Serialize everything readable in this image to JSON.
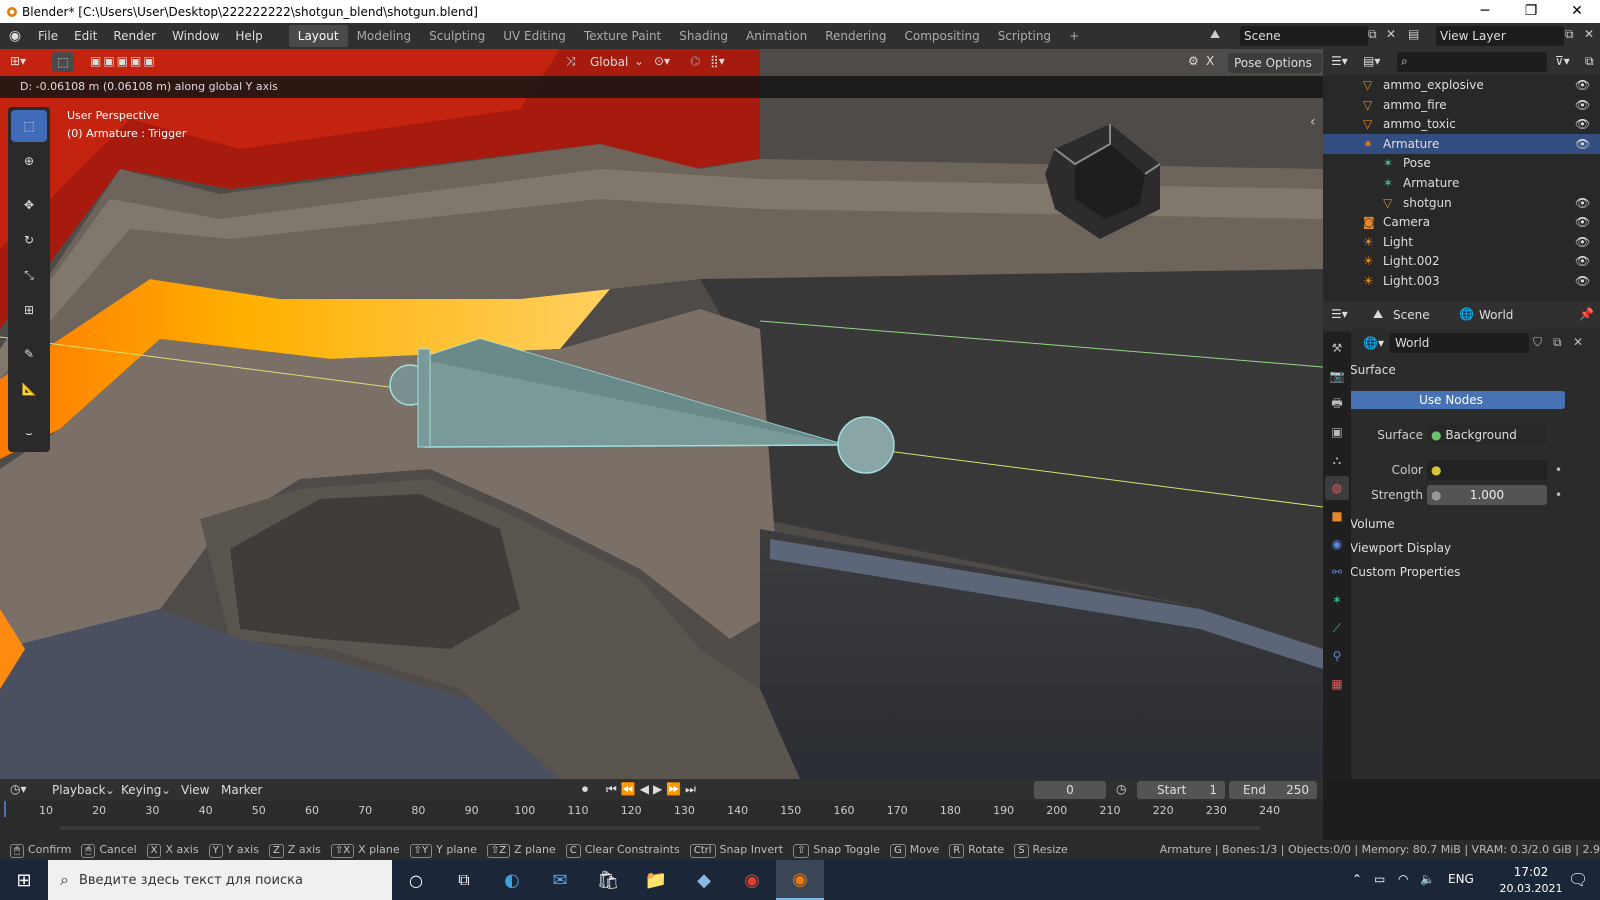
{
  "window": {
    "title": "Blender* [C:\\Users\\User\\Desktop\\222222222\\shotgun_blend\\shotgun.blend]"
  },
  "menu": [
    "File",
    "Edit",
    "Render",
    "Window",
    "Help"
  ],
  "workspaces": [
    "Layout",
    "Modeling",
    "Sculpting",
    "UV Editing",
    "Texture Paint",
    "Shading",
    "Animation",
    "Rendering",
    "Compositing",
    "Scripting"
  ],
  "active_workspace": "Layout",
  "scene": {
    "name": "Scene",
    "view_layer": "View Layer"
  },
  "viewport": {
    "orientation": "Global",
    "pose_options": "Pose Options",
    "header_status": "D: -0.06108 m (0.06108 m) along global Y axis",
    "perspective": "User Perspective",
    "object_info": "(0) Armature : Trigger"
  },
  "outliner": {
    "items": [
      {
        "label": "ammo_explosive",
        "indent": 1,
        "icon": "mesh-icon"
      },
      {
        "label": "ammo_fire",
        "indent": 1,
        "icon": "mesh-icon"
      },
      {
        "label": "ammo_toxic",
        "indent": 1,
        "icon": "mesh-icon"
      },
      {
        "label": "Armature",
        "indent": 1,
        "icon": "armature-icon",
        "selected": true
      },
      {
        "label": "Pose",
        "indent": 2,
        "icon": "pose-icon"
      },
      {
        "label": "Armature",
        "indent": 2,
        "icon": "armature-data-icon"
      },
      {
        "label": "shotgun",
        "indent": 2,
        "icon": "mesh-icon"
      },
      {
        "label": "Camera",
        "indent": 1,
        "icon": "camera-icon"
      },
      {
        "label": "Light",
        "indent": 1,
        "icon": "light-icon"
      },
      {
        "label": "Light.002",
        "indent": 1,
        "icon": "light-icon"
      },
      {
        "label": "Light.003",
        "indent": 1,
        "icon": "light-icon"
      }
    ]
  },
  "properties": {
    "breadcrumb_scene": "Scene",
    "breadcrumb_world": "World",
    "world_name": "World",
    "panel_surface": "Surface",
    "use_nodes": "Use Nodes",
    "surface_label": "Surface",
    "surface_value": "Background",
    "color_label": "Color",
    "strength_label": "Strength",
    "strength_value": "1.000",
    "panel_volume": "Volume",
    "panel_viewport_display": "Viewport Display",
    "panel_custom_properties": "Custom Properties"
  },
  "timeline": {
    "menus": [
      "Playback",
      "Keying",
      "View",
      "Marker"
    ],
    "current_frame": "0",
    "start_label": "Start",
    "start_value": "1",
    "end_label": "End",
    "end_value": "250",
    "ticks": [
      "10",
      "20",
      "30",
      "40",
      "50",
      "60",
      "70",
      "80",
      "90",
      "100",
      "110",
      "120",
      "130",
      "140",
      "150",
      "160",
      "170",
      "180",
      "190",
      "200",
      "210",
      "220",
      "230",
      "240"
    ]
  },
  "statusbar": {
    "hints": [
      {
        "key": "",
        "label": "Confirm"
      },
      {
        "key": "",
        "label": "Cancel"
      },
      {
        "key": "X",
        "label": "X axis"
      },
      {
        "key": "Y",
        "label": "Y axis"
      },
      {
        "key": "Z",
        "label": "Z axis"
      },
      {
        "key": "⇧X",
        "label": "X plane"
      },
      {
        "key": "⇧Y",
        "label": "Y plane"
      },
      {
        "key": "⇧Z",
        "label": "Z plane"
      },
      {
        "key": "C",
        "label": "Clear Constraints"
      },
      {
        "key": "Ctrl",
        "label": "Snap Invert"
      },
      {
        "key": "⇧",
        "label": "Snap Toggle"
      },
      {
        "key": "G",
        "label": "Move"
      },
      {
        "key": "R",
        "label": "Rotate"
      },
      {
        "key": "S",
        "label": "Resize"
      }
    ],
    "info": "Armature | Bones:1/3 | Objects:0/0 | Memory: 80.7 MiB | VRAM: 0.3/2.0 GiB | 2.9"
  },
  "taskbar": {
    "search_placeholder": "Введите здесь текст для поиска",
    "lang": "ENG",
    "time": "17:02",
    "date": "20.03.2021"
  },
  "colors": {
    "accent_blue": "#4772b3",
    "selection_bg": "#334d80",
    "bone_fill": "#7a9999"
  }
}
